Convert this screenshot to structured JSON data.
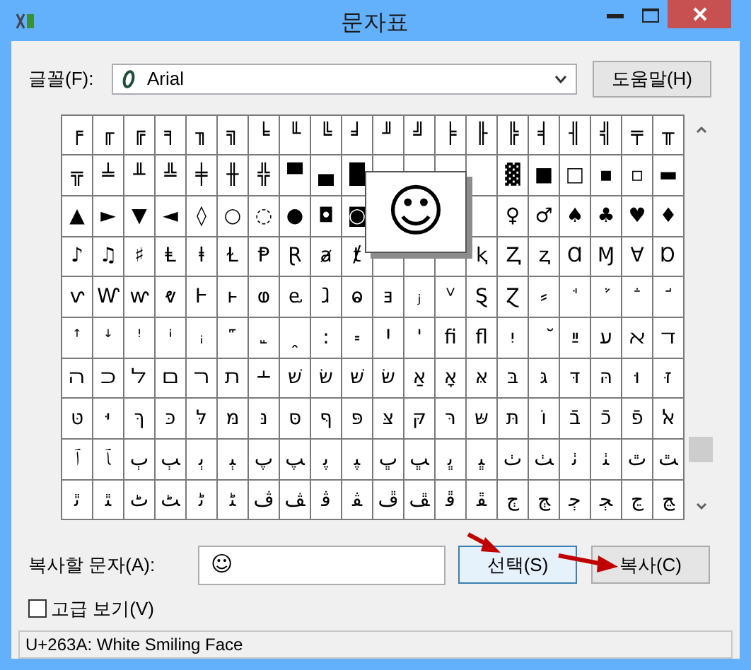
{
  "window": {
    "title": "문자표"
  },
  "font": {
    "label": "글꼴(F):",
    "value": "Arial"
  },
  "help_button": "도움말(H)",
  "grid": {
    "rows": [
      [
        "╒",
        "╓",
        "╔",
        "╕",
        "╖",
        "╗",
        "╘",
        "╙",
        "╚",
        "╛",
        "╜",
        "╝",
        "╞",
        "╟",
        "╠",
        "╡",
        "╢",
        "╣",
        "╤",
        "╥"
      ],
      [
        "╦",
        "╧",
        "╨",
        "╩",
        "╪",
        "╫",
        "╬",
        "▀",
        "▄",
        "█",
        null,
        null,
        null,
        null,
        "▓",
        "■",
        "□",
        "▪",
        "▫",
        "▬"
      ],
      [
        "▲",
        "►",
        "▼",
        "◄",
        "◊",
        "○",
        "◌",
        "●",
        "◘",
        "◙",
        null,
        null,
        null,
        null,
        "♀",
        "♂",
        "♠",
        "♣",
        "♥",
        "♦"
      ],
      [
        "♪",
        "♫",
        "♯",
        "Ⱡ",
        "ⱡ",
        "Ɫ",
        "Ᵽ",
        "Ɽ",
        "ⱥ",
        "ⱦ",
        null,
        null,
        null,
        "ⱪ",
        "Ⱬ",
        "ⱬ",
        "Ɑ",
        "Ɱ",
        "Ɐ",
        "Ɒ"
      ],
      [
        "ⱱ",
        "Ⱳ",
        "ⱳ",
        "ⱴ",
        "Ⱶ",
        "ⱶ",
        "ⱷ",
        "ⱸ",
        "ⱹ",
        "ⱺ",
        "ⱻ",
        "ⱼ",
        "ⱽ",
        "Ȿ",
        "Ɀ",
        "⸗",
        "ꜗ",
        "ꜘ",
        "ꜙ",
        "ꜚ"
      ],
      [
        "ꜛ",
        "ꜜ",
        "ꜝ",
        "ꜞ",
        "ꜟ",
        "꜠",
        "꜡",
        "ꞈ",
        "꞉",
        "꞊",
        "Ꞌ",
        "ꞌ",
        "ﬁ",
        "ﬂ",
        "יִ",
        "ﬞ",
        "ײַ",
        "ﬠ",
        "ﬡ",
        "ﬢ"
      ],
      [
        "ﬣ",
        "ﬤ",
        "ﬥ",
        "ﬦ",
        "ﬧ",
        "ﬨ",
        "﬩",
        "שׁ",
        "שׂ",
        "שּׁ",
        "שּׂ",
        "אַ",
        "אָ",
        "אּ",
        "בּ",
        "גּ",
        "דּ",
        "הּ",
        "וּ",
        "זּ"
      ],
      [
        "טּ",
        "יּ",
        "ךּ",
        "כּ",
        "לּ",
        "מּ",
        "נּ",
        "סּ",
        "ףּ",
        "פּ",
        "צּ",
        "קּ",
        "רּ",
        "שּ",
        "תּ",
        "וֹ",
        "בֿ",
        "כֿ",
        "פֿ",
        "ﭏ"
      ],
      [
        "ﭐ",
        "ﭑ",
        "ﭒ",
        "ﭓ",
        "ﭔ",
        "ﭕ",
        "ﭖ",
        "ﭗ",
        "ﭘ",
        "ﭙ",
        "ﭚ",
        "ﭛ",
        "ﭜ",
        "ﭝ",
        "ﭞ",
        "ﭟ",
        "ﭠ",
        "ﭡ",
        "ﭢ",
        "ﭣ"
      ],
      [
        "ﭤ",
        "ﭥ",
        "ﭦ",
        "ﭧ",
        "ﭨ",
        "ﭩ",
        "ﭪ",
        "ﭫ",
        "ﭬ",
        "ﭭ",
        "ﭮ",
        "ﭯ",
        "ﭰ",
        "ﭱ",
        "ﭲ",
        "ﭳ",
        "ﭴ",
        "ﭵ",
        "ﭶ",
        "ﭷ"
      ]
    ]
  },
  "magnifier": {
    "char": "☺"
  },
  "copy_field": {
    "label": "복사할 문자(A):",
    "value": "☺"
  },
  "buttons": [
    {
      "label": "선택(S)",
      "focused": true
    },
    {
      "label": "복사(C)",
      "focused": false
    }
  ],
  "advanced_view": {
    "label": "고급 보기(V)",
    "checked": false
  },
  "status_bar": "U+263A: White Smiling Face"
}
